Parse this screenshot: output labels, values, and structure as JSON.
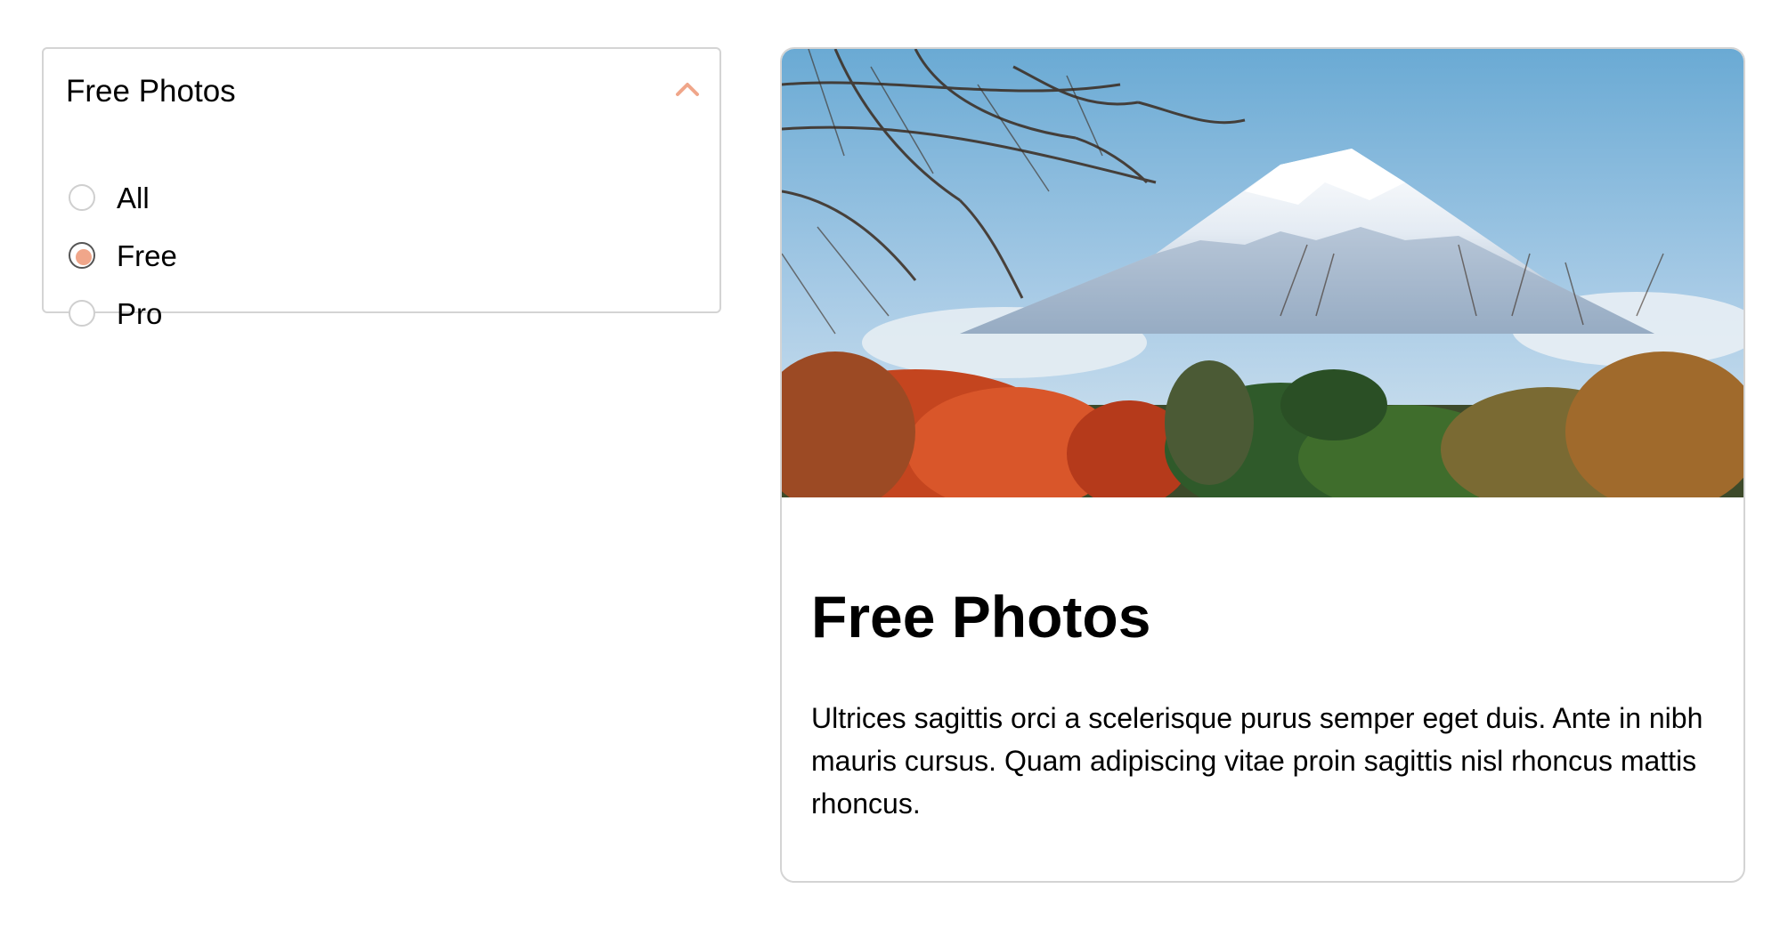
{
  "filter": {
    "title": "Free Photos",
    "expanded": true,
    "chevron_icon": "chevron-up-icon",
    "accent_color": "#f0a68a",
    "options": [
      {
        "label": "All",
        "selected": false
      },
      {
        "label": "Free",
        "selected": true
      },
      {
        "label": "Pro",
        "selected": false
      }
    ]
  },
  "card": {
    "image_icon": "mountain-autumn-photo",
    "title": "Free Photos",
    "description": "Ultrices sagittis orci a scelerisque purus semper eget duis. Ante in nibh mauris cursus. Quam adipiscing vitae proin sagittis nisl rhoncus mattis rhoncus."
  }
}
